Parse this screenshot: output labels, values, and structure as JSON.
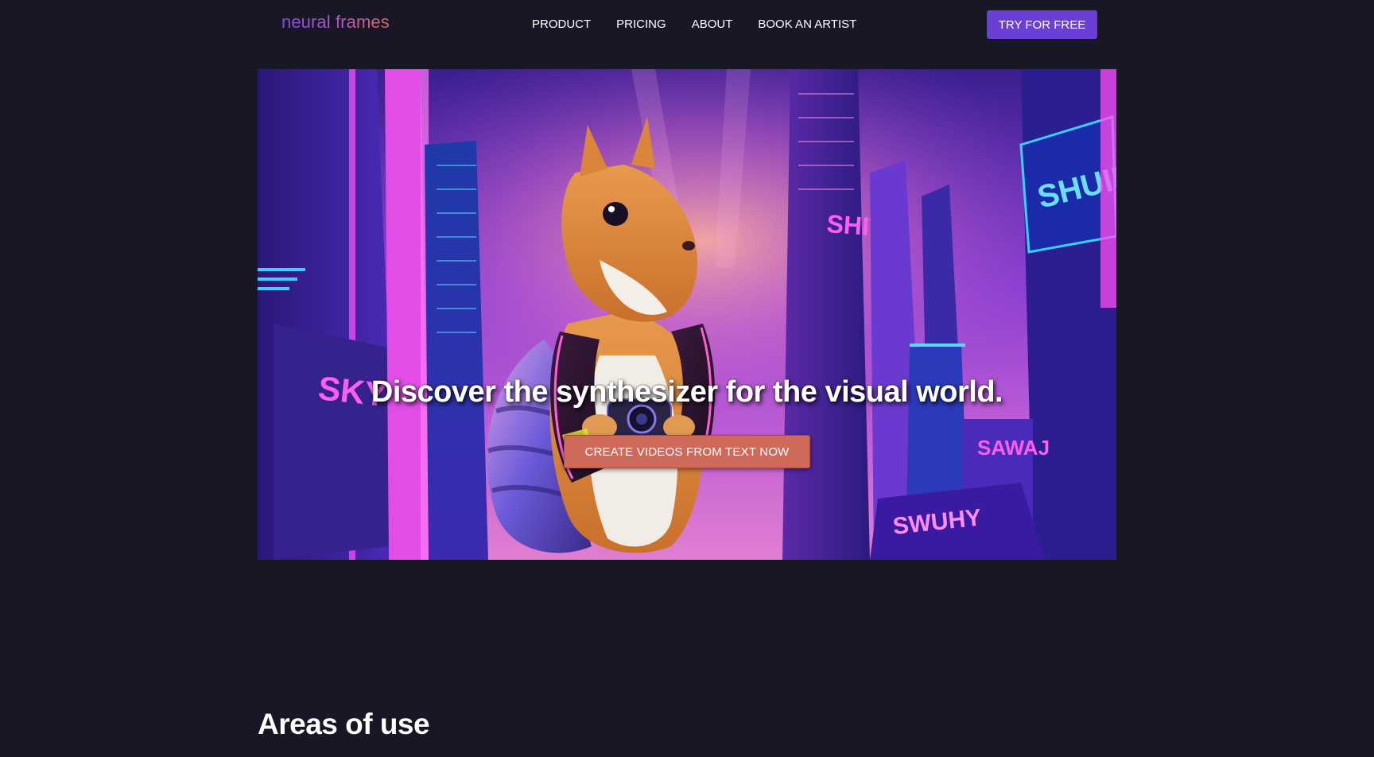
{
  "header": {
    "logo_text": "neural frames",
    "nav": [
      {
        "label": "PRODUCT"
      },
      {
        "label": "PRICING"
      },
      {
        "label": "ABOUT"
      },
      {
        "label": "BOOK AN ARTIST"
      }
    ],
    "cta_label": "TRY FOR FREE"
  },
  "hero": {
    "title": "Discover the synthesizer for the visual world.",
    "cta_label": "CREATE VIDEOS FROM TEXT NOW",
    "image": "squirrel-with-camera-in-neon-cyberpunk-city"
  },
  "sections": {
    "areas_title": "Areas of use"
  },
  "colors": {
    "background": "#171726",
    "brand_purple": "#6b3fd6",
    "cta_coral": "#cf6a5a",
    "logo_gradient": [
      "#7e4fe0",
      "#d46a66"
    ]
  }
}
